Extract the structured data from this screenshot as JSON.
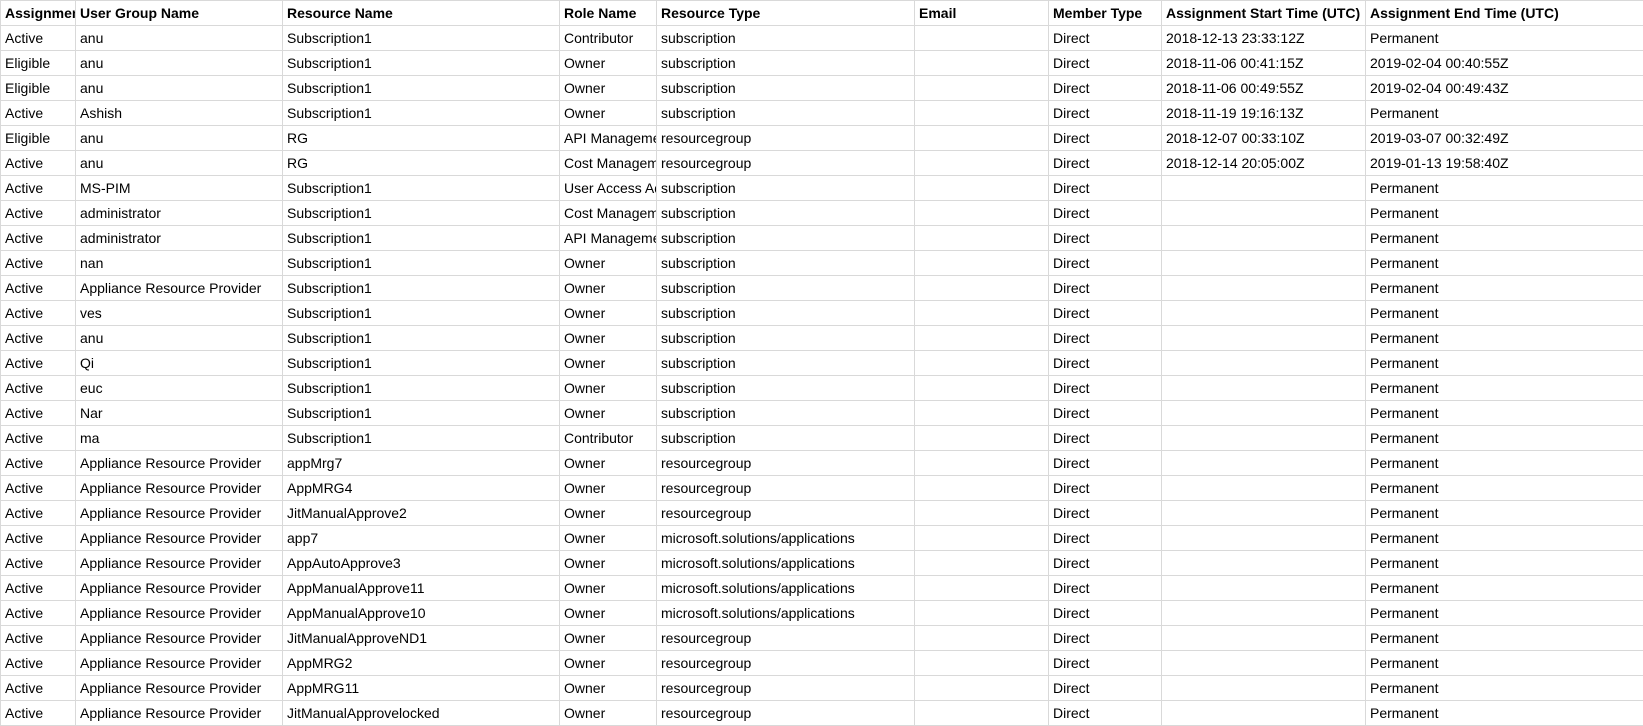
{
  "table": {
    "headers": [
      "Assignment",
      "User Group Name",
      "Resource Name",
      "Role Name",
      "Resource Type",
      "Email",
      "Member Type",
      "Assignment Start Time (UTC)",
      "Assignment End Time (UTC)"
    ],
    "rows": [
      {
        "assignment": "Active",
        "user": "anu",
        "resource": "Subscription1",
        "role": "Contributor",
        "rtype": "subscription",
        "email": "",
        "member": "Direct",
        "start": "2018-12-13 23:33:12Z",
        "end": "Permanent"
      },
      {
        "assignment": "Eligible",
        "user": "anu",
        "resource": "Subscription1",
        "role": "Owner",
        "rtype": "subscription",
        "email": "",
        "member": "Direct",
        "start": "2018-11-06 00:41:15Z",
        "end": "2019-02-04 00:40:55Z"
      },
      {
        "assignment": "Eligible",
        "user": "anu",
        "resource": "Subscription1",
        "role": "Owner",
        "rtype": "subscription",
        "email": "",
        "member": "Direct",
        "start": "2018-11-06 00:49:55Z",
        "end": "2019-02-04 00:49:43Z"
      },
      {
        "assignment": "Active",
        "user": "Ashish",
        "resource": "Subscription1",
        "role": "Owner",
        "rtype": "subscription",
        "email": "",
        "member": "Direct",
        "start": "2018-11-19 19:16:13Z",
        "end": "Permanent"
      },
      {
        "assignment": "Eligible",
        "user": "anu",
        "resource": "RG",
        "role": "API Management",
        "rtype": "resourcegroup",
        "email": "",
        "member": "Direct",
        "start": "2018-12-07 00:33:10Z",
        "end": "2019-03-07 00:32:49Z"
      },
      {
        "assignment": "Active",
        "user": "anu",
        "resource": "RG",
        "role": "Cost Management",
        "rtype": "resourcegroup",
        "email": "",
        "member": "Direct",
        "start": "2018-12-14 20:05:00Z",
        "end": "2019-01-13 19:58:40Z"
      },
      {
        "assignment": "Active",
        "user": "MS-PIM",
        "resource": "Subscription1",
        "role": "User Access Administrator",
        "rtype": "subscription",
        "email": "",
        "member": "Direct",
        "start": "",
        "end": "Permanent"
      },
      {
        "assignment": "Active",
        "user": "administrator",
        "resource": "Subscription1",
        "role": "Cost Management",
        "rtype": "subscription",
        "email": "",
        "member": "Direct",
        "start": "",
        "end": "Permanent"
      },
      {
        "assignment": "Active",
        "user": "administrator",
        "resource": "Subscription1",
        "role": "API Management",
        "rtype": "subscription",
        "email": "",
        "member": "Direct",
        "start": "",
        "end": "Permanent"
      },
      {
        "assignment": "Active",
        "user": "nan",
        "resource": "Subscription1",
        "role": "Owner",
        "rtype": "subscription",
        "email": "",
        "member": "Direct",
        "start": "",
        "end": "Permanent"
      },
      {
        "assignment": "Active",
        "user": "Appliance Resource Provider",
        "resource": "Subscription1",
        "role": "Owner",
        "rtype": "subscription",
        "email": "",
        "member": "Direct",
        "start": "",
        "end": "Permanent"
      },
      {
        "assignment": "Active",
        "user": "ves",
        "resource": "Subscription1",
        "role": "Owner",
        "rtype": "subscription",
        "email": "",
        "member": "Direct",
        "start": "",
        "end": "Permanent"
      },
      {
        "assignment": "Active",
        "user": "anu",
        "resource": "Subscription1",
        "role": "Owner",
        "rtype": "subscription",
        "email": "",
        "member": "Direct",
        "start": "",
        "end": "Permanent"
      },
      {
        "assignment": "Active",
        "user": "Qi",
        "resource": "Subscription1",
        "role": "Owner",
        "rtype": "subscription",
        "email": "",
        "member": "Direct",
        "start": "",
        "end": "Permanent"
      },
      {
        "assignment": "Active",
        "user": "euc",
        "resource": "Subscription1",
        "role": "Owner",
        "rtype": "subscription",
        "email": "",
        "member": "Direct",
        "start": "",
        "end": "Permanent"
      },
      {
        "assignment": "Active",
        "user": "Nar",
        "resource": "Subscription1",
        "role": "Owner",
        "rtype": "subscription",
        "email": "",
        "member": "Direct",
        "start": "",
        "end": "Permanent"
      },
      {
        "assignment": "Active",
        "user": "ma",
        "resource": "Subscription1",
        "role": "Contributor",
        "rtype": "subscription",
        "email": "",
        "member": "Direct",
        "start": "",
        "end": "Permanent"
      },
      {
        "assignment": "Active",
        "user": "Appliance Resource Provider",
        "resource": "appMrg7",
        "role": "Owner",
        "rtype": "resourcegroup",
        "email": "",
        "member": "Direct",
        "start": "",
        "end": "Permanent"
      },
      {
        "assignment": "Active",
        "user": "Appliance Resource Provider",
        "resource": "AppMRG4",
        "role": "Owner",
        "rtype": "resourcegroup",
        "email": "",
        "member": "Direct",
        "start": "",
        "end": "Permanent"
      },
      {
        "assignment": "Active",
        "user": "Appliance Resource Provider",
        "resource": "JitManualApprove2",
        "role": "Owner",
        "rtype": "resourcegroup",
        "email": "",
        "member": "Direct",
        "start": "",
        "end": "Permanent"
      },
      {
        "assignment": "Active",
        "user": "Appliance Resource Provider",
        "resource": "app7",
        "role": "Owner",
        "rtype": "microsoft.solutions/applications",
        "email": "",
        "member": "Direct",
        "start": "",
        "end": "Permanent"
      },
      {
        "assignment": "Active",
        "user": "Appliance Resource Provider",
        "resource": "AppAutoApprove3",
        "role": "Owner",
        "rtype": "microsoft.solutions/applications",
        "email": "",
        "member": "Direct",
        "start": "",
        "end": "Permanent"
      },
      {
        "assignment": "Active",
        "user": "Appliance Resource Provider",
        "resource": "AppManualApprove11",
        "role": "Owner",
        "rtype": "microsoft.solutions/applications",
        "email": "",
        "member": "Direct",
        "start": "",
        "end": "Permanent"
      },
      {
        "assignment": "Active",
        "user": "Appliance Resource Provider",
        "resource": "AppManualApprove10",
        "role": "Owner",
        "rtype": "microsoft.solutions/applications",
        "email": "",
        "member": "Direct",
        "start": "",
        "end": "Permanent"
      },
      {
        "assignment": "Active",
        "user": "Appliance Resource Provider",
        "resource": "JitManualApproveND1",
        "role": "Owner",
        "rtype": "resourcegroup",
        "email": "",
        "member": "Direct",
        "start": "",
        "end": "Permanent"
      },
      {
        "assignment": "Active",
        "user": "Appliance Resource Provider",
        "resource": "AppMRG2",
        "role": "Owner",
        "rtype": "resourcegroup",
        "email": "",
        "member": "Direct",
        "start": "",
        "end": "Permanent"
      },
      {
        "assignment": "Active",
        "user": "Appliance Resource Provider",
        "resource": "AppMRG11",
        "role": "Owner",
        "rtype": "resourcegroup",
        "email": "",
        "member": "Direct",
        "start": "",
        "end": "Permanent"
      },
      {
        "assignment": "Active",
        "user": "Appliance Resource Provider",
        "resource": "JitManualApprovelocked",
        "role": "Owner",
        "rtype": "resourcegroup",
        "email": "",
        "member": "Direct",
        "start": "",
        "end": "Permanent"
      }
    ]
  }
}
